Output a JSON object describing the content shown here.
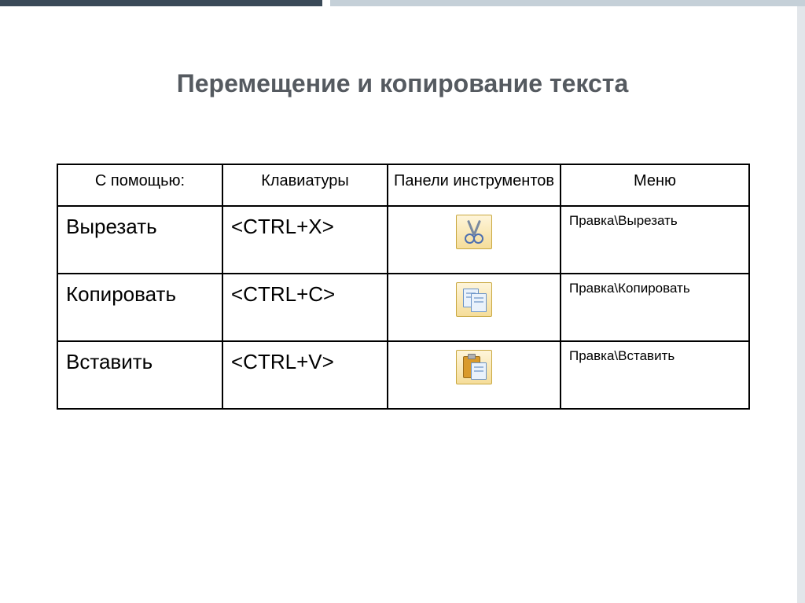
{
  "title": "Перемещение и копирование текста",
  "headers": {
    "col1": "С помощью:",
    "col2": "Клавиатуры",
    "col3": "Панели инструментов",
    "col4": "Меню"
  },
  "rows": [
    {
      "action": "Вырезать",
      "shortcut": "<CTRL+X>",
      "icon": "cut-icon",
      "menu": "Правка\\Вырезать"
    },
    {
      "action": "Копировать",
      "shortcut": "<CTRL+C>",
      "icon": "copy-icon",
      "menu": "Правка\\Копировать"
    },
    {
      "action": "Вставить",
      "shortcut": "<CTRL+V>",
      "icon": "paste-icon",
      "menu": "Правка\\Вставить"
    }
  ]
}
